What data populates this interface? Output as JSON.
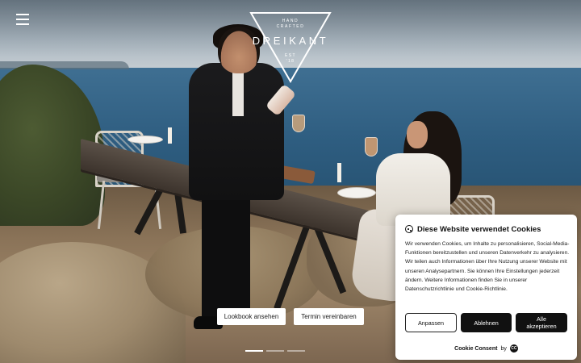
{
  "header": {
    "menu_icon": "hamburger-menu-icon",
    "logo": {
      "top_line1": "HAND",
      "top_line2": "CRAFTED",
      "wordmark": "DREIKANT",
      "est_line1": "EST",
      "est_line2": "'18"
    }
  },
  "hero": {
    "image_subject": "couple at dining table on cliff overlooking sea",
    "cta_primary": "Lookbook ansehen",
    "cta_secondary": "Termin vereinbaren",
    "slides_total": 3,
    "slide_active": 1
  },
  "cookie_banner": {
    "icon": "cookie-icon",
    "title": "Diese Website verwendet Cookies",
    "body": "Wir verwenden Cookies, um Inhalte zu personalisieren, Social-Media-Funktionen bereitzustellen und unseren Datenverkehr zu analysieren. Wir teilen auch Informationen über Ihre Nutzung unserer Website mit unseren Analysepartnern. Sie können Ihre Einstellungen jederzeit ändern. Weitere Informationen finden Sie in unserer Datenschutzrichtlinie und Cookie-Richtlinie.",
    "btn_customize": "Anpassen",
    "btn_reject": "Ablehnen",
    "btn_accept": "Alle akzeptieren",
    "footer_brand": "Cookie Consent",
    "footer_by": "by",
    "footer_logo": "CC"
  }
}
